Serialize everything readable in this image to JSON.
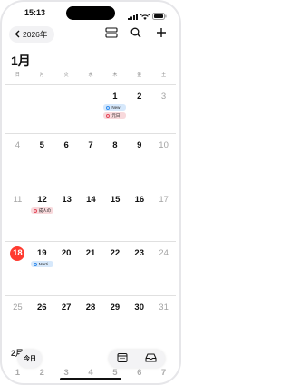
{
  "status_bar": {
    "time": "15:13"
  },
  "toolbar": {
    "back_label": "2026年"
  },
  "month": {
    "title": "1月",
    "next_title": "2月"
  },
  "weekdays": [
    "日",
    "月",
    "火",
    "水",
    "木",
    "金",
    "土"
  ],
  "weeks": [
    {
      "days": [
        "",
        "",
        "",
        "",
        "1",
        "2",
        "3"
      ],
      "events": [
        {
          "col": 4,
          "label": "New",
          "color": "blue"
        },
        {
          "col": 4,
          "label": "元日",
          "color": "red"
        }
      ]
    },
    {
      "days": [
        "4",
        "5",
        "6",
        "7",
        "8",
        "9",
        "10"
      ],
      "events": []
    },
    {
      "days": [
        "11",
        "12",
        "13",
        "14",
        "15",
        "16",
        "17"
      ],
      "events": [
        {
          "col": 1,
          "label": "成人の",
          "color": "red"
        }
      ]
    },
    {
      "days": [
        "18",
        "19",
        "20",
        "21",
        "22",
        "23",
        "24"
      ],
      "events": [
        {
          "col": 1,
          "label": "Marti",
          "color": "blue"
        }
      ]
    },
    {
      "days": [
        "25",
        "26",
        "27",
        "28",
        "29",
        "30",
        "31"
      ],
      "events": []
    }
  ],
  "today": "18",
  "next_month_partial": [
    "1",
    "2",
    "3",
    "4",
    "5",
    "6",
    "7"
  ],
  "bottom": {
    "today_label": "今日"
  },
  "colors": {
    "accent": "#ff3b30",
    "event_blue": "#2f8cf0",
    "event_red": "#e5485a"
  }
}
